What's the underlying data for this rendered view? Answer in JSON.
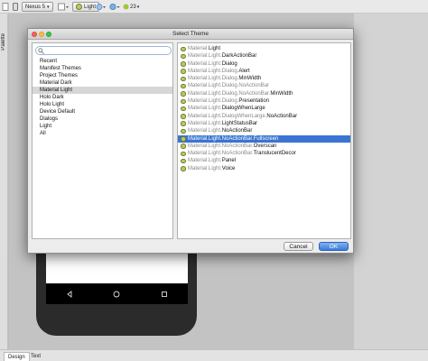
{
  "toolbar": {
    "device_label": "Nexus 5",
    "theme_label": "Light",
    "api_label": "23"
  },
  "sidebar": {
    "palette_label": "Palette"
  },
  "bottom_tabs": {
    "design_label": "Design",
    "text_label": "Text"
  },
  "dialog": {
    "title": "Select Theme",
    "search": {
      "value": "",
      "placeholder": ""
    },
    "categories": [
      {
        "label": "Recent"
      },
      {
        "label": "Manifest Themes"
      },
      {
        "label": "Project Themes"
      },
      {
        "label": "Material Dark"
      },
      {
        "label": "Material Light",
        "selected": true
      },
      {
        "label": "Holo Dark"
      },
      {
        "label": "Holo Light"
      },
      {
        "label": "Device Default"
      },
      {
        "label": "Dialogs"
      },
      {
        "label": "Light"
      },
      {
        "label": "All"
      }
    ],
    "themes": [
      {
        "prefix": "Material.",
        "suffix": "Light"
      },
      {
        "prefix": "Material.Light.",
        "suffix": "DarkActionBar"
      },
      {
        "prefix": "Material.Light.",
        "suffix": "Dialog"
      },
      {
        "prefix": "Material.Light.Dialog.",
        "suffix": "Alert"
      },
      {
        "prefix": "Material.Light.Dialog.",
        "suffix": "MinWidth"
      },
      {
        "prefix": "Material.Light.Dialog.NoActionBar",
        "suffix": ""
      },
      {
        "prefix": "Material.Light.Dialog.NoActionBar.",
        "suffix": "MinWidth"
      },
      {
        "prefix": "Material.Light.Dialog.",
        "suffix": "Presentation"
      },
      {
        "prefix": "Material.Light.",
        "suffix": "DialogWhenLarge"
      },
      {
        "prefix": "Material.Light.DialogWhenLarge.",
        "suffix": "NoActionBar"
      },
      {
        "prefix": "Material.Light.",
        "suffix": "LightStatusBar"
      },
      {
        "prefix": "Material.Light.",
        "suffix": "NoActionBar"
      },
      {
        "prefix": "Material.Light.NoActionBar.",
        "suffix": "Fullscreen",
        "selected": true
      },
      {
        "prefix": "Material.Light.NoActionBar.",
        "suffix": "Overscan"
      },
      {
        "prefix": "Material.Light.NoActionBar.",
        "suffix": "TranslucentDecor"
      },
      {
        "prefix": "Material.Light.",
        "suffix": "Panel"
      },
      {
        "prefix": "Material.Light.",
        "suffix": "Voice"
      }
    ],
    "cancel_label": "Cancel",
    "ok_label": "OK"
  },
  "colors": {
    "selection_blue": "#3b74d2",
    "ok_button": "#3b7ad8",
    "theme_icon": "#b9c96a"
  },
  "icons": [
    "search-icon",
    "theme-icon",
    "back-nav-icon",
    "home-nav-icon",
    "recents-nav-icon"
  ]
}
